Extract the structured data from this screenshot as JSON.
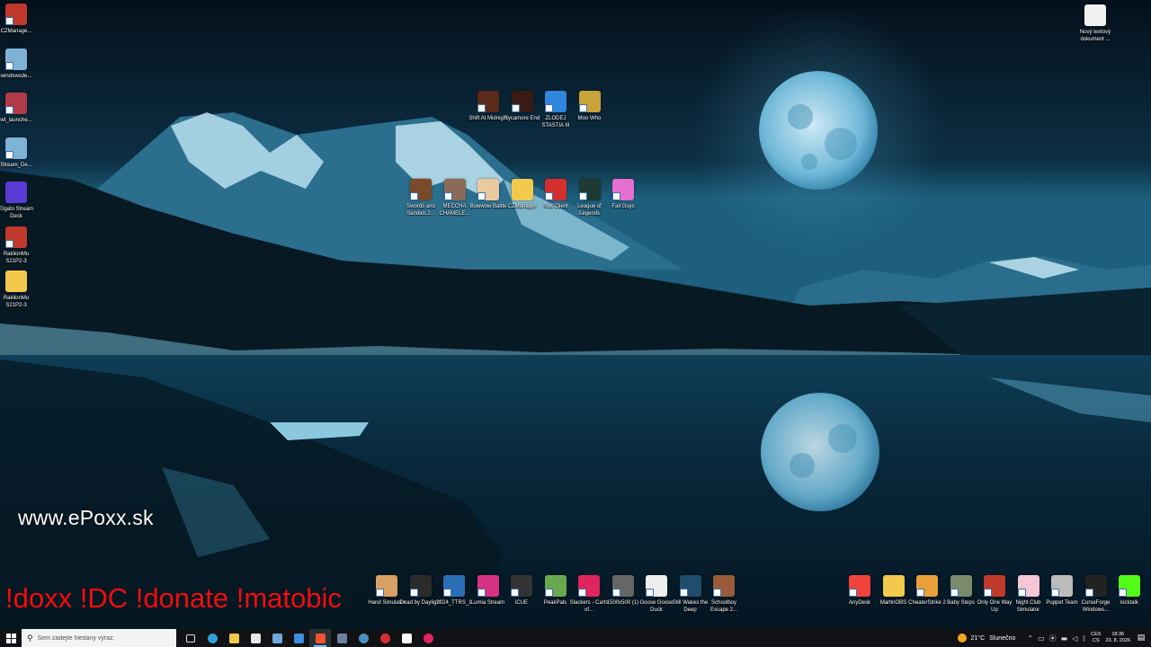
{
  "desktop": {
    "left_column": [
      {
        "label": "CZManage...",
        "icon": "winrar-icon",
        "color": "#c0392b"
      },
      {
        "label": "windowsde...",
        "icon": "installer-icon",
        "color": "#7fb3d5"
      },
      {
        "label": "wt_launche...",
        "icon": "warthunder-icon",
        "color": "#b03a48"
      },
      {
        "label": "Stream_De...",
        "icon": "installer-icon",
        "color": "#7fb3d5"
      },
      {
        "label": "Elgato Stream Deck",
        "icon": "elgato-icon",
        "color": "#5b3bd6"
      },
      {
        "label": "RaklionMu S21P2-3",
        "icon": "winrar-icon",
        "color": "#c0392b"
      },
      {
        "label": "RaklionMu S21P2-3",
        "icon": "folder-icon",
        "color": "#f2c94c"
      }
    ],
    "top_right": {
      "label": "Nový textový dokument ...",
      "icon": "text-file-icon",
      "color": "#f0f0f0"
    },
    "center_row1": [
      {
        "label": "Shift At Midnight",
        "icon": "game-icon",
        "color": "#5a2a1a"
      },
      {
        "label": "Sycamore End",
        "icon": "game-icon",
        "color": "#3a1a14"
      },
      {
        "label": "ZLODEJ STASTIA III",
        "icon": "globe-icon",
        "color": "#2e86de"
      },
      {
        "label": "Moo Who",
        "icon": "game-icon",
        "color": "#c9a43a"
      }
    ],
    "center_row2": [
      {
        "label": "Swords and Sandals 2...",
        "icon": "game-icon",
        "color": "#7a4a2a"
      },
      {
        "label": "MECCHA CHAMELE...",
        "icon": "game-icon",
        "color": "#8a6a5a"
      },
      {
        "label": "Bowwow Battle",
        "icon": "game-icon",
        "color": "#e8c9a0"
      },
      {
        "label": "CZManager",
        "icon": "folder-icon",
        "color": "#f2c94c"
      },
      {
        "label": "Riot Client",
        "icon": "riot-icon",
        "color": "#d32f2f"
      },
      {
        "label": "League of Legends",
        "icon": "league-icon",
        "color": "#1d3a33"
      },
      {
        "label": "Fall Guys",
        "icon": "fallguys-icon",
        "color": "#e46fd1"
      }
    ],
    "bottom_row": [
      {
        "label": "Hand Simulator",
        "icon": "hand-icon",
        "color": "#d9a066"
      },
      {
        "label": "Dead by Daylight",
        "icon": "dbd-icon",
        "color": "#2b2b2b"
      },
      {
        "label": "2024_TTRS_1",
        "icon": "image-icon",
        "color": "#2a6fb5"
      },
      {
        "label": "Lumia Stream",
        "icon": "lumia-icon",
        "color": "#d63384"
      },
      {
        "label": "iCUE",
        "icon": "icue-icon",
        "color": "#333333"
      },
      {
        "label": "PeakPals",
        "icon": "game-icon",
        "color": "#6aa84f"
      },
      {
        "label": "Slackers - Carts of...",
        "icon": "slackers-icon",
        "color": "#e0245e"
      },
      {
        "label": "1500x500 (1)",
        "icon": "image-icon",
        "color": "#666666"
      },
      {
        "label": "Goose Goose Duck",
        "icon": "goose-icon",
        "color": "#eeeeee"
      },
      {
        "label": "Still Wakes the Deep",
        "icon": "game-icon",
        "color": "#1f4d6b"
      },
      {
        "label": "Schoolboy Escape 2...",
        "icon": "game-icon",
        "color": "#9a5b3a"
      }
    ],
    "bottom_right_row": [
      {
        "label": "AnyDesk",
        "icon": "anydesk-icon",
        "color": "#ef443b"
      },
      {
        "label": "MartinOBS",
        "icon": "folder-icon",
        "color": "#f2c94c"
      },
      {
        "label": "CheaterStrike 2",
        "icon": "game-icon",
        "color": "#e8a13a"
      },
      {
        "label": "Baby Steps",
        "icon": "game-icon",
        "color": "#7a8a6a"
      },
      {
        "label": "Only One Way Up",
        "icon": "game-icon",
        "color": "#c0392b"
      },
      {
        "label": "Night Club Simulator",
        "icon": "game-icon",
        "color": "#f5c6d6"
      },
      {
        "label": "Puppet Team",
        "icon": "game-icon",
        "color": "#bbbbbb"
      },
      {
        "label": "CurseForge Windows...",
        "icon": "curseforge-icon",
        "color": "#222222"
      },
      {
        "label": "kicktalk",
        "icon": "kick-icon",
        "color": "#53fc18"
      }
    ]
  },
  "overlay": {
    "site_url": "www.ePoxx.sk",
    "commands": "!doxx  !DC !donate !matobic"
  },
  "taskbar": {
    "search_placeholder": "Sem zadejte hledaný výraz.",
    "pinned": [
      {
        "name": "task-view-icon",
        "color": "#dddddd",
        "active": false
      },
      {
        "name": "edge-icon",
        "color": "#2f9fd8",
        "active": false
      },
      {
        "name": "file-explorer-icon",
        "color": "#f2c94c",
        "active": false
      },
      {
        "name": "store-icon",
        "color": "#e6e6e6",
        "active": false
      },
      {
        "name": "copilot-icon",
        "color": "#6fa8dc",
        "active": false
      },
      {
        "name": "mail-icon",
        "color": "#3d8fe0",
        "active": false
      },
      {
        "name": "brave-icon",
        "color": "#f1542f",
        "active": true
      },
      {
        "name": "generic-app-icon",
        "color": "#6c7fa1",
        "active": false
      },
      {
        "name": "steam-icon",
        "color": "#4a90c2",
        "active": false
      },
      {
        "name": "riot-icon",
        "color": "#d32f2f",
        "active": false
      },
      {
        "name": "obs-icon",
        "color": "#ffffff",
        "active": false
      },
      {
        "name": "record-icon",
        "color": "#e0245e",
        "active": false
      }
    ],
    "weather": {
      "temp": "21°C",
      "condition": "Slunečno"
    },
    "language": {
      "top": "CES",
      "bottom": "CS"
    },
    "clock": {
      "time": "18:36",
      "date": "23. 8. 2026"
    }
  }
}
